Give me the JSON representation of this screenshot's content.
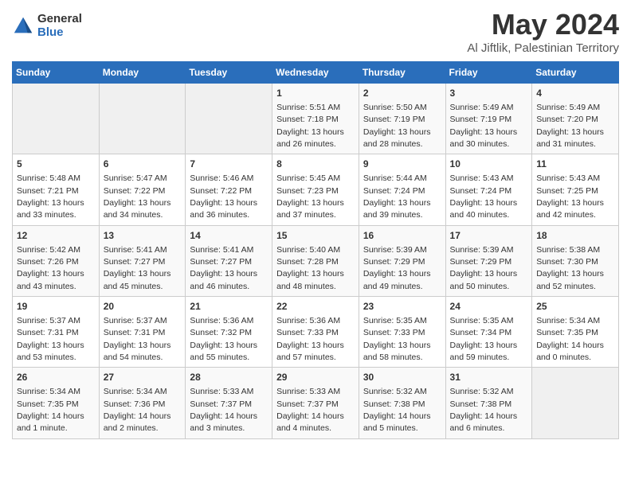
{
  "logo": {
    "general": "General",
    "blue": "Blue"
  },
  "title": "May 2024",
  "subtitle": "Al Jiftlik, Palestinian Territory",
  "days_of_week": [
    "Sunday",
    "Monday",
    "Tuesday",
    "Wednesday",
    "Thursday",
    "Friday",
    "Saturday"
  ],
  "weeks": [
    [
      {
        "day": "",
        "sunrise": "",
        "sunset": "",
        "daylight": "",
        "empty": true
      },
      {
        "day": "",
        "sunrise": "",
        "sunset": "",
        "daylight": "",
        "empty": true
      },
      {
        "day": "",
        "sunrise": "",
        "sunset": "",
        "daylight": "",
        "empty": true
      },
      {
        "day": "1",
        "sunrise": "Sunrise: 5:51 AM",
        "sunset": "Sunset: 7:18 PM",
        "daylight": "Daylight: 13 hours and 26 minutes."
      },
      {
        "day": "2",
        "sunrise": "Sunrise: 5:50 AM",
        "sunset": "Sunset: 7:19 PM",
        "daylight": "Daylight: 13 hours and 28 minutes."
      },
      {
        "day": "3",
        "sunrise": "Sunrise: 5:49 AM",
        "sunset": "Sunset: 7:19 PM",
        "daylight": "Daylight: 13 hours and 30 minutes."
      },
      {
        "day": "4",
        "sunrise": "Sunrise: 5:49 AM",
        "sunset": "Sunset: 7:20 PM",
        "daylight": "Daylight: 13 hours and 31 minutes."
      }
    ],
    [
      {
        "day": "5",
        "sunrise": "Sunrise: 5:48 AM",
        "sunset": "Sunset: 7:21 PM",
        "daylight": "Daylight: 13 hours and 33 minutes."
      },
      {
        "day": "6",
        "sunrise": "Sunrise: 5:47 AM",
        "sunset": "Sunset: 7:22 PM",
        "daylight": "Daylight: 13 hours and 34 minutes."
      },
      {
        "day": "7",
        "sunrise": "Sunrise: 5:46 AM",
        "sunset": "Sunset: 7:22 PM",
        "daylight": "Daylight: 13 hours and 36 minutes."
      },
      {
        "day": "8",
        "sunrise": "Sunrise: 5:45 AM",
        "sunset": "Sunset: 7:23 PM",
        "daylight": "Daylight: 13 hours and 37 minutes."
      },
      {
        "day": "9",
        "sunrise": "Sunrise: 5:44 AM",
        "sunset": "Sunset: 7:24 PM",
        "daylight": "Daylight: 13 hours and 39 minutes."
      },
      {
        "day": "10",
        "sunrise": "Sunrise: 5:43 AM",
        "sunset": "Sunset: 7:24 PM",
        "daylight": "Daylight: 13 hours and 40 minutes."
      },
      {
        "day": "11",
        "sunrise": "Sunrise: 5:43 AM",
        "sunset": "Sunset: 7:25 PM",
        "daylight": "Daylight: 13 hours and 42 minutes."
      }
    ],
    [
      {
        "day": "12",
        "sunrise": "Sunrise: 5:42 AM",
        "sunset": "Sunset: 7:26 PM",
        "daylight": "Daylight: 13 hours and 43 minutes."
      },
      {
        "day": "13",
        "sunrise": "Sunrise: 5:41 AM",
        "sunset": "Sunset: 7:27 PM",
        "daylight": "Daylight: 13 hours and 45 minutes."
      },
      {
        "day": "14",
        "sunrise": "Sunrise: 5:41 AM",
        "sunset": "Sunset: 7:27 PM",
        "daylight": "Daylight: 13 hours and 46 minutes."
      },
      {
        "day": "15",
        "sunrise": "Sunrise: 5:40 AM",
        "sunset": "Sunset: 7:28 PM",
        "daylight": "Daylight: 13 hours and 48 minutes."
      },
      {
        "day": "16",
        "sunrise": "Sunrise: 5:39 AM",
        "sunset": "Sunset: 7:29 PM",
        "daylight": "Daylight: 13 hours and 49 minutes."
      },
      {
        "day": "17",
        "sunrise": "Sunrise: 5:39 AM",
        "sunset": "Sunset: 7:29 PM",
        "daylight": "Daylight: 13 hours and 50 minutes."
      },
      {
        "day": "18",
        "sunrise": "Sunrise: 5:38 AM",
        "sunset": "Sunset: 7:30 PM",
        "daylight": "Daylight: 13 hours and 52 minutes."
      }
    ],
    [
      {
        "day": "19",
        "sunrise": "Sunrise: 5:37 AM",
        "sunset": "Sunset: 7:31 PM",
        "daylight": "Daylight: 13 hours and 53 minutes."
      },
      {
        "day": "20",
        "sunrise": "Sunrise: 5:37 AM",
        "sunset": "Sunset: 7:31 PM",
        "daylight": "Daylight: 13 hours and 54 minutes."
      },
      {
        "day": "21",
        "sunrise": "Sunrise: 5:36 AM",
        "sunset": "Sunset: 7:32 PM",
        "daylight": "Daylight: 13 hours and 55 minutes."
      },
      {
        "day": "22",
        "sunrise": "Sunrise: 5:36 AM",
        "sunset": "Sunset: 7:33 PM",
        "daylight": "Daylight: 13 hours and 57 minutes."
      },
      {
        "day": "23",
        "sunrise": "Sunrise: 5:35 AM",
        "sunset": "Sunset: 7:33 PM",
        "daylight": "Daylight: 13 hours and 58 minutes."
      },
      {
        "day": "24",
        "sunrise": "Sunrise: 5:35 AM",
        "sunset": "Sunset: 7:34 PM",
        "daylight": "Daylight: 13 hours and 59 minutes."
      },
      {
        "day": "25",
        "sunrise": "Sunrise: 5:34 AM",
        "sunset": "Sunset: 7:35 PM",
        "daylight": "Daylight: 14 hours and 0 minutes."
      }
    ],
    [
      {
        "day": "26",
        "sunrise": "Sunrise: 5:34 AM",
        "sunset": "Sunset: 7:35 PM",
        "daylight": "Daylight: 14 hours and 1 minute."
      },
      {
        "day": "27",
        "sunrise": "Sunrise: 5:34 AM",
        "sunset": "Sunset: 7:36 PM",
        "daylight": "Daylight: 14 hours and 2 minutes."
      },
      {
        "day": "28",
        "sunrise": "Sunrise: 5:33 AM",
        "sunset": "Sunset: 7:37 PM",
        "daylight": "Daylight: 14 hours and 3 minutes."
      },
      {
        "day": "29",
        "sunrise": "Sunrise: 5:33 AM",
        "sunset": "Sunset: 7:37 PM",
        "daylight": "Daylight: 14 hours and 4 minutes."
      },
      {
        "day": "30",
        "sunrise": "Sunrise: 5:32 AM",
        "sunset": "Sunset: 7:38 PM",
        "daylight": "Daylight: 14 hours and 5 minutes."
      },
      {
        "day": "31",
        "sunrise": "Sunrise: 5:32 AM",
        "sunset": "Sunset: 7:38 PM",
        "daylight": "Daylight: 14 hours and 6 minutes."
      },
      {
        "day": "",
        "sunrise": "",
        "sunset": "",
        "daylight": "",
        "empty": true
      }
    ]
  ]
}
